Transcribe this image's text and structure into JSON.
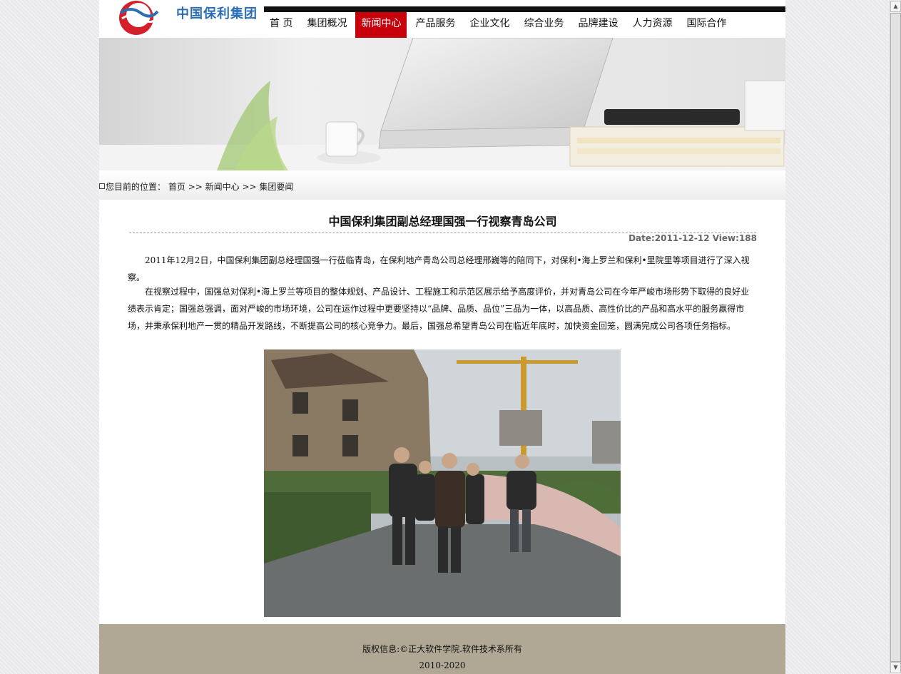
{
  "header": {
    "logo_text": "中国保利集团",
    "nav": [
      {
        "label": "首  页",
        "active": false
      },
      {
        "label": "集团概况",
        "active": false
      },
      {
        "label": "新闻中心",
        "active": true
      },
      {
        "label": "产品服务",
        "active": false
      },
      {
        "label": "企业文化",
        "active": false
      },
      {
        "label": "综合业务",
        "active": false
      },
      {
        "label": "品牌建设",
        "active": false
      },
      {
        "label": "人力资源",
        "active": false
      },
      {
        "label": "国际合作",
        "active": false
      }
    ]
  },
  "breadcrumb": {
    "prefix": "您目前的位置：",
    "items": [
      "首页",
      ">> 新闻中心",
      ">> 集团要闻"
    ]
  },
  "article": {
    "title": "中国保利集团副总经理国强一行视察青岛公司",
    "meta": "Date:2011-12-12 View:188",
    "paragraphs": [
      "2011年12月2日，中国保利集团副总经理国强一行莅临青岛，在保利地产青岛公司总经理邢巍等的陪同下，对保利•海上罗兰和保利•里院里等项目进行了深入视察。",
      "在视察过程中，国强总对保利•海上罗兰等项目的整体规划、产品设计、工程施工和示范区展示给予高度评价，并对青岛公司在今年严峻市场形势下取得的良好业绩表示肯定；国强总强调，面对严峻的市场环境，公司在运作过程中更要坚持以“品牌、品质、品位”三品为一体，以高品质、高性价比的产品和高水平的服务赢得市场，并秉承保利地产一贯的精品开发路线，不断提高公司的核心竞争力。最后，国强总希望青岛公司在临近年底时，加快资金回笼，圆满完成公司各项任务指标。"
    ]
  },
  "footer": {
    "copyright": "版权信息:©正大软件学院.软件技术系所有",
    "years": "2010-2020"
  },
  "colors": {
    "nav_active": "#c8000b",
    "footer_bg": "#b1a795",
    "logo_blue": "#2b6db3",
    "logo_red": "#d4202a"
  }
}
